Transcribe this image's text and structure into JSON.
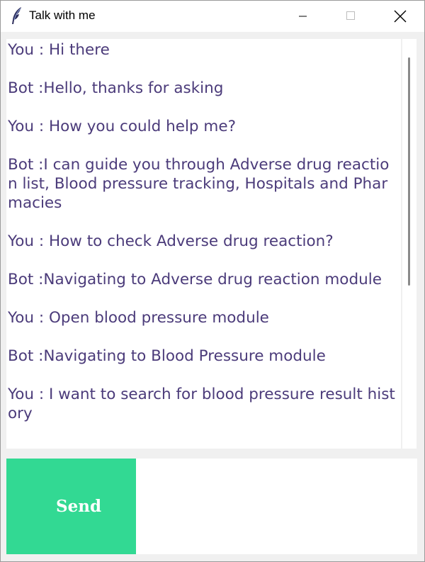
{
  "window": {
    "title": "Talk with me",
    "icon": "feather-icon",
    "controls": [
      "minimize-icon",
      "maximize-icon",
      "close-icon"
    ]
  },
  "chat": {
    "messages": [
      "You : Hi there",
      "Bot :Hello, thanks for asking",
      "You : How you could help me?",
      "Bot :I can guide you through Adverse drug reaction list, Blood pressure tracking, Hospitals and Pharmacies",
      "You : How to check Adverse drug reaction?",
      "Bot :Navigating to Adverse drug reaction module",
      "You : Open blood pressure module",
      "Bot :Navigating to Blood Pressure module",
      "You : I want to search for blood pressure result history"
    ],
    "text_color": "#4b3b7a"
  },
  "input": {
    "send_label": "Send",
    "value": "",
    "send_color": "#32d993"
  }
}
